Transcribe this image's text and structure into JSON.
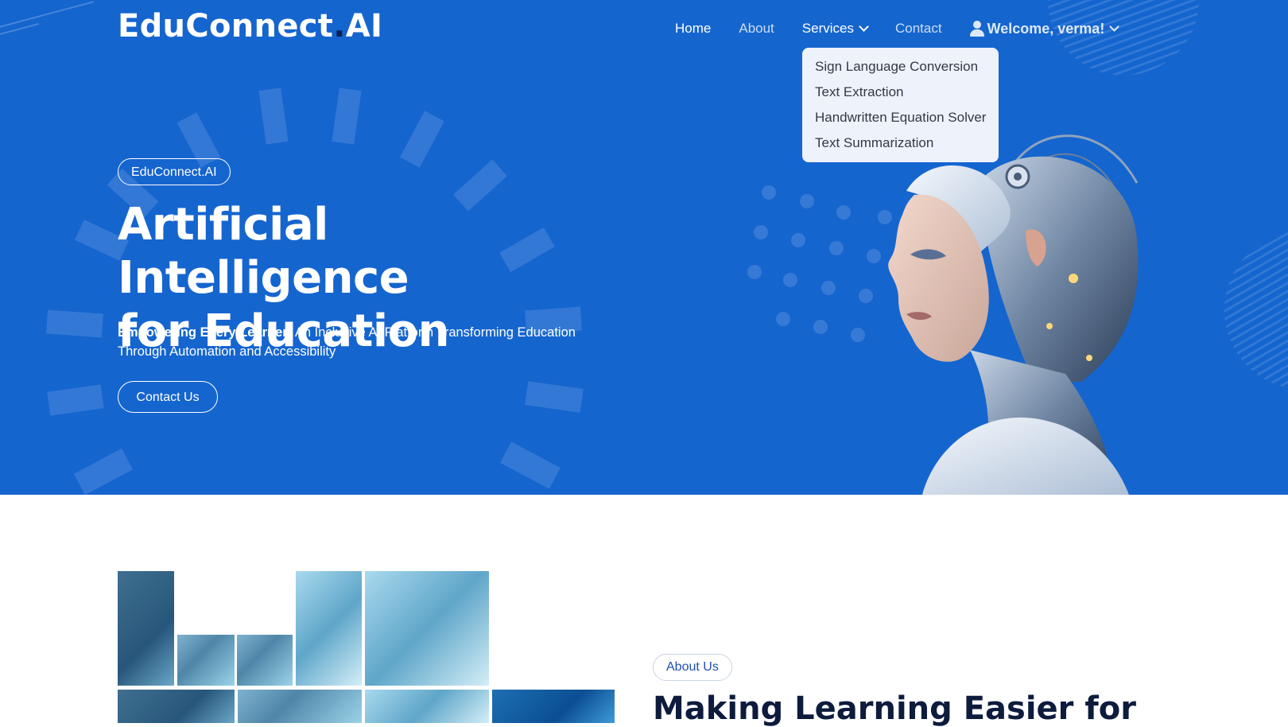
{
  "brand": {
    "name_part1": "EduConnect",
    "dot": ".",
    "name_part2": "AI"
  },
  "nav": {
    "items": [
      {
        "label": "Home"
      },
      {
        "label": "About"
      },
      {
        "label": "Services"
      },
      {
        "label": "Contact"
      }
    ],
    "welcome": "Welcome, verma!"
  },
  "services_menu": {
    "items": [
      {
        "label": "Sign Language Conversion"
      },
      {
        "label": "Text Extraction"
      },
      {
        "label": "Handwritten Equation Solver"
      },
      {
        "label": "Text Summarization"
      }
    ]
  },
  "hero": {
    "badge": "EduConnect.AI",
    "title_line1": "Artificial Intelligence",
    "title_line2": "for Education",
    "subtitle_bold": "Empowering Every Learner:",
    "subtitle_rest": " An Inclusive AI Platform Transforming Education Through Automation and Accessibility",
    "cta": "Contact Us"
  },
  "about": {
    "badge": "About Us",
    "title": "Making Learning Easier for"
  },
  "colors": {
    "hero_bg": "#1565cf",
    "logo_dot": "#0b2257",
    "dropdown_bg": "#eef2fb",
    "about_title": "#0d1b3d",
    "about_badge_text": "#1f4fb0"
  },
  "icons": {
    "user": "user-icon",
    "services_caret": "chevron-down-icon",
    "welcome_caret": "chevron-down-icon"
  }
}
